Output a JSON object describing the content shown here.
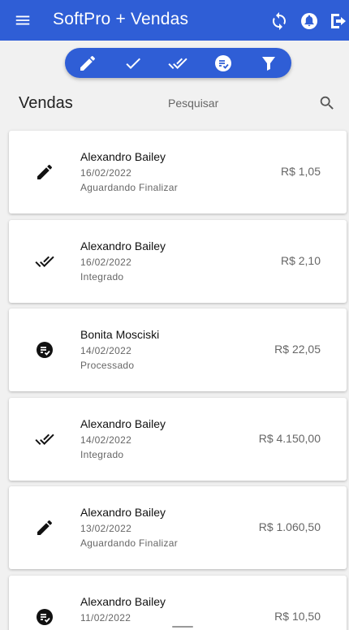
{
  "app": {
    "title": "SoftPro + Vendas"
  },
  "header": {
    "title": "Vendas"
  },
  "search": {
    "placeholder": "Pesquisar"
  },
  "sales": [
    {
      "customer": "Alexandro Bailey",
      "date": "16/02/2022",
      "status": "Aguardando Finalizar",
      "value": "R$ 1,05",
      "icon": "pencil-icon"
    },
    {
      "customer": "Alexandro Bailey",
      "date": "16/02/2022",
      "status": "Integrado",
      "value": "R$ 2,10",
      "icon": "double-check-icon"
    },
    {
      "customer": "Bonita Mosciski",
      "date": "14/02/2022",
      "status": "Processado",
      "value": "R$ 22,05",
      "icon": "processed-icon"
    },
    {
      "customer": "Alexandro Bailey",
      "date": "14/02/2022",
      "status": "Integrado",
      "value": "R$ 4.150,00",
      "icon": "double-check-icon"
    },
    {
      "customer": "Alexandro Bailey",
      "date": "13/02/2022",
      "status": "Aguardando Finalizar",
      "value": "R$ 1.060,50",
      "icon": "pencil-icon"
    },
    {
      "customer": "Alexandro Bailey",
      "date": "11/02/2022",
      "status": "",
      "value": "R$ 10,50",
      "icon": "processed-icon"
    }
  ]
}
